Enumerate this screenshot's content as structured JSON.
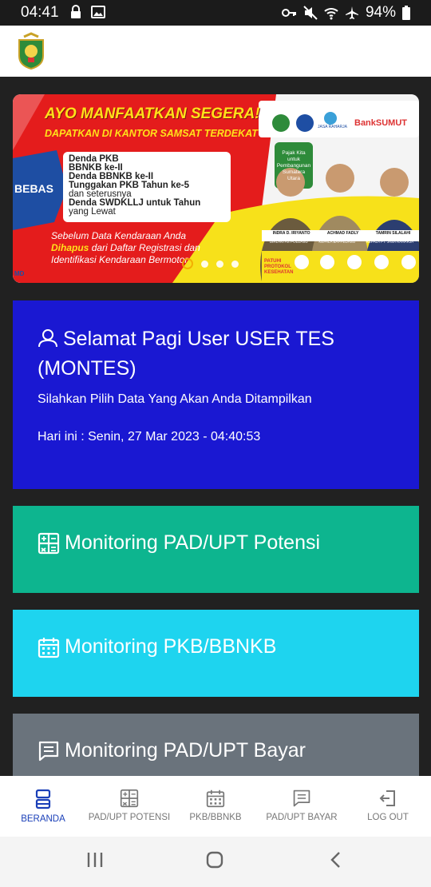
{
  "status_bar": {
    "time": "04:41",
    "battery": "94%"
  },
  "banner": {
    "headline": "AYO MANFAATKAN SEGERA!",
    "subheadline": "DAPATKAN DI KANTOR SAMSAT TERDEKAT",
    "bebas": "BEBAS",
    "items": [
      "Denda PKB",
      "BBNKB ke-II",
      "Denda BBNKB ke-II",
      "Tunggakan PKB Tahun ke-5",
      "dan seterusnya",
      "Denda SWDKLLJ untuk Tahun",
      "yang Lewat"
    ],
    "footer_line1": "Sebelum Data Kendaraan Anda",
    "footer_line2_hl": "Dihapus",
    "footer_line2_rest": "dari Daftar Registrasi dan",
    "footer_line3": "Identifikasi Kendaraan Bermotor",
    "bank": "BankSUMUT",
    "jasa": "JASA RAHARJA",
    "quote": "Pajak Kita untuk Pembangunan Sumatera Utara",
    "people": [
      "INDRA D. IRIYANTO",
      "ACHMAD FADLY",
      "TAMRIN SILALAHI"
    ],
    "roles": [
      "DIRLANTAS POLDASU",
      "KEPALA BAPPEDASU",
      "KEPALA PT. JASA RAHARJA"
    ],
    "protokol": "PATUHI PROTOKOL KESEHATAN",
    "corner": "MD"
  },
  "welcome": {
    "greeting": "Selamat Pagi User USER TES (MONTES)",
    "subtitle": "Silahkan Pilih Data Yang Akan Anda Ditampilkan",
    "date_prefix": "Hari ini : ",
    "date_value": "Senin, 27 Mar 2023 - 04:40:53"
  },
  "menu": {
    "potensi": "Monitoring PAD/UPT Potensi",
    "pkb": "Monitoring PKB/BBNKB",
    "bayar": "Monitoring PAD/UPT Bayar"
  },
  "bottom_nav": {
    "beranda": "BERANDA",
    "potensi": "PAD/UPT POTENSI",
    "pkb": "PKB/BBNKB",
    "bayar": "PAD/UPT BAYAR",
    "logout": "LOG OUT"
  },
  "colors": {
    "welcome_bg": "#1a18d2",
    "potensi_bg": "#0db58f",
    "pkb_bg": "#1ed4ef",
    "bayar_bg": "#6a737c",
    "nav_active": "#1a3fb8"
  }
}
